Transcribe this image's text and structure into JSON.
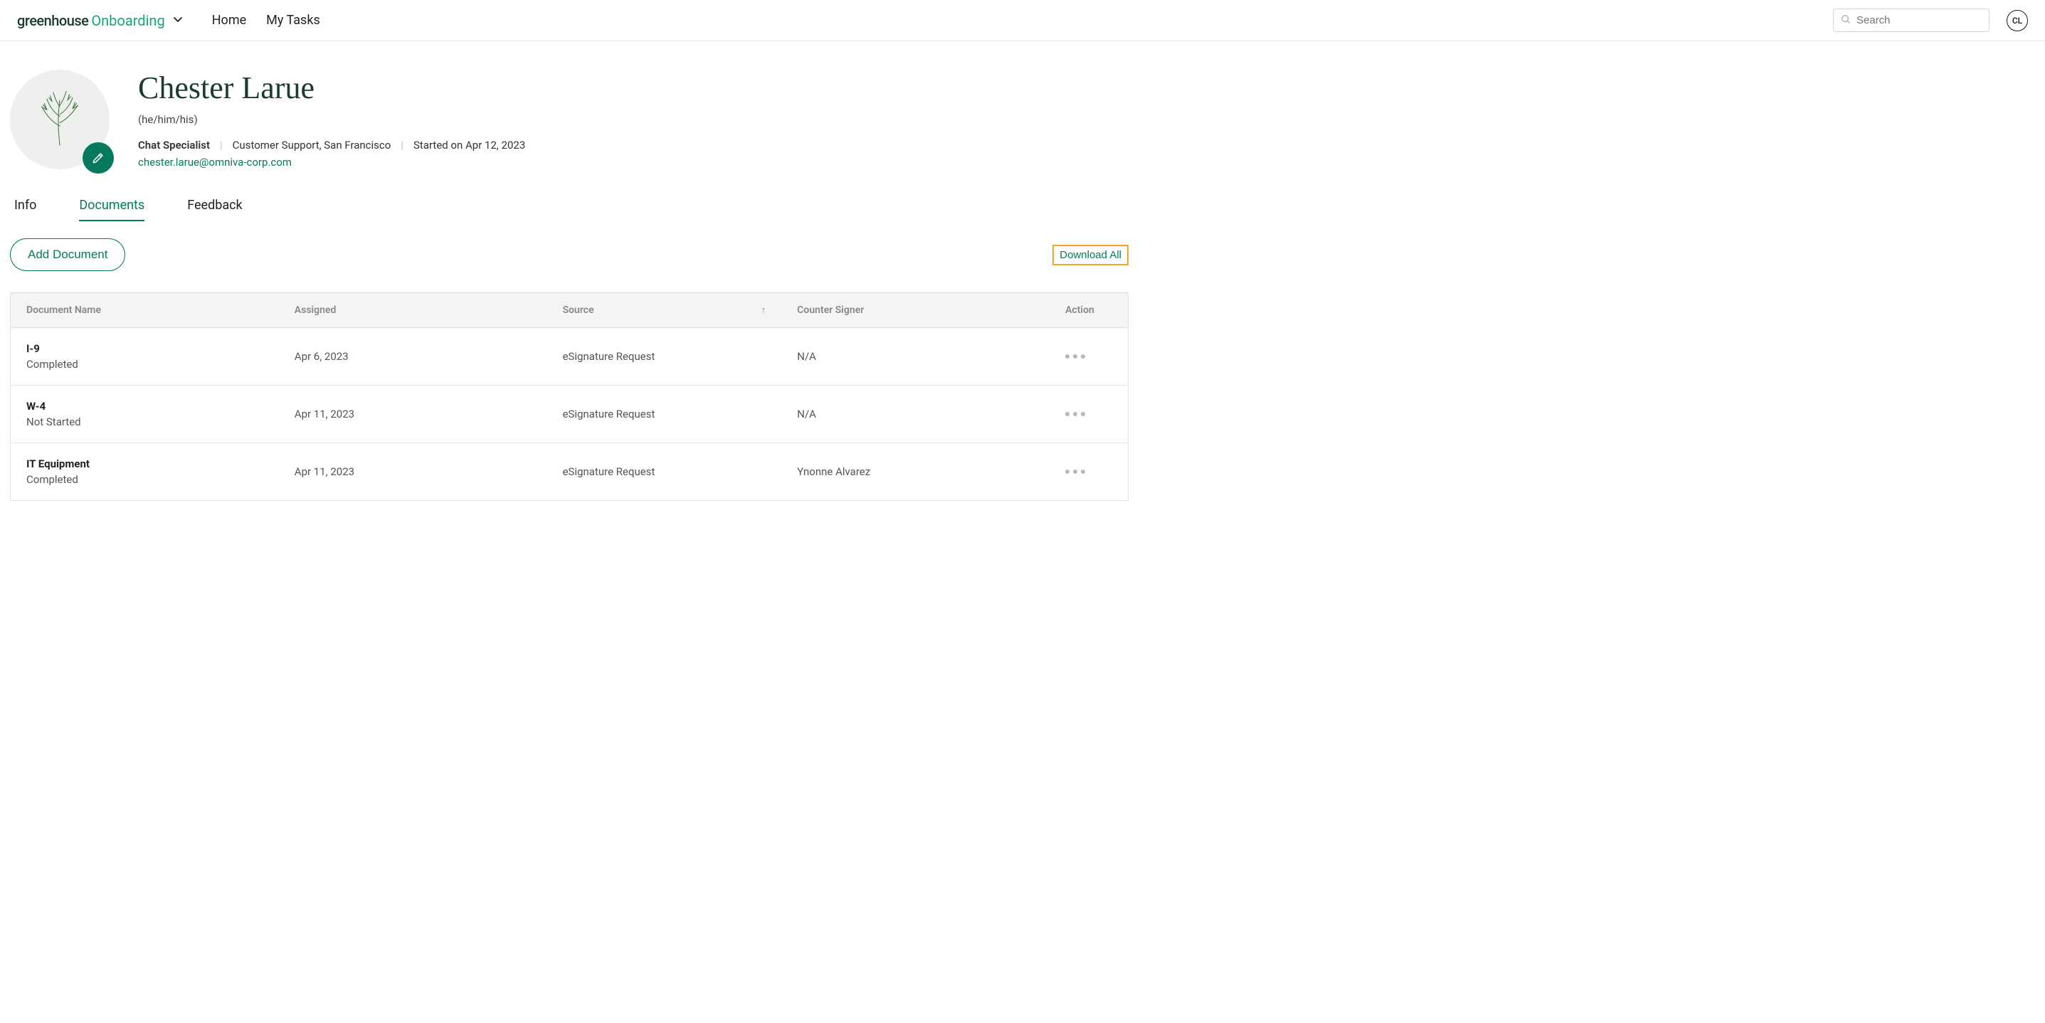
{
  "header": {
    "logo_primary": "greenhouse",
    "logo_secondary": "Onboarding",
    "nav": {
      "home": "Home",
      "my_tasks": "My Tasks"
    },
    "search_placeholder": "Search",
    "avatar_initials": "CL"
  },
  "profile": {
    "name": "Chester Larue",
    "pronouns": "(he/him/his)",
    "role": "Chat Specialist",
    "department_location": "Customer Support, San Francisco",
    "started": "Started on Apr 12, 2023",
    "email": "chester.larue@omniva-corp.com"
  },
  "tabs": {
    "info": "Info",
    "documents": "Documents",
    "feedback": "Feedback"
  },
  "actions": {
    "add_document": "Add Document",
    "download_all": "Download All"
  },
  "table": {
    "headers": {
      "document_name": "Document Name",
      "assigned": "Assigned",
      "source": "Source",
      "counter_signer": "Counter Signer",
      "action": "Action"
    },
    "rows": [
      {
        "name": "I-9",
        "status": "Completed",
        "assigned": "Apr 6, 2023",
        "source": "eSignature Request",
        "counter_signer": "N/A"
      },
      {
        "name": "W-4",
        "status": "Not Started",
        "assigned": "Apr 11, 2023",
        "source": "eSignature Request",
        "counter_signer": "N/A"
      },
      {
        "name": "IT Equipment",
        "status": "Completed",
        "assigned": "Apr 11, 2023",
        "source": "eSignature Request",
        "counter_signer": "Ynonne Alvarez"
      }
    ]
  }
}
